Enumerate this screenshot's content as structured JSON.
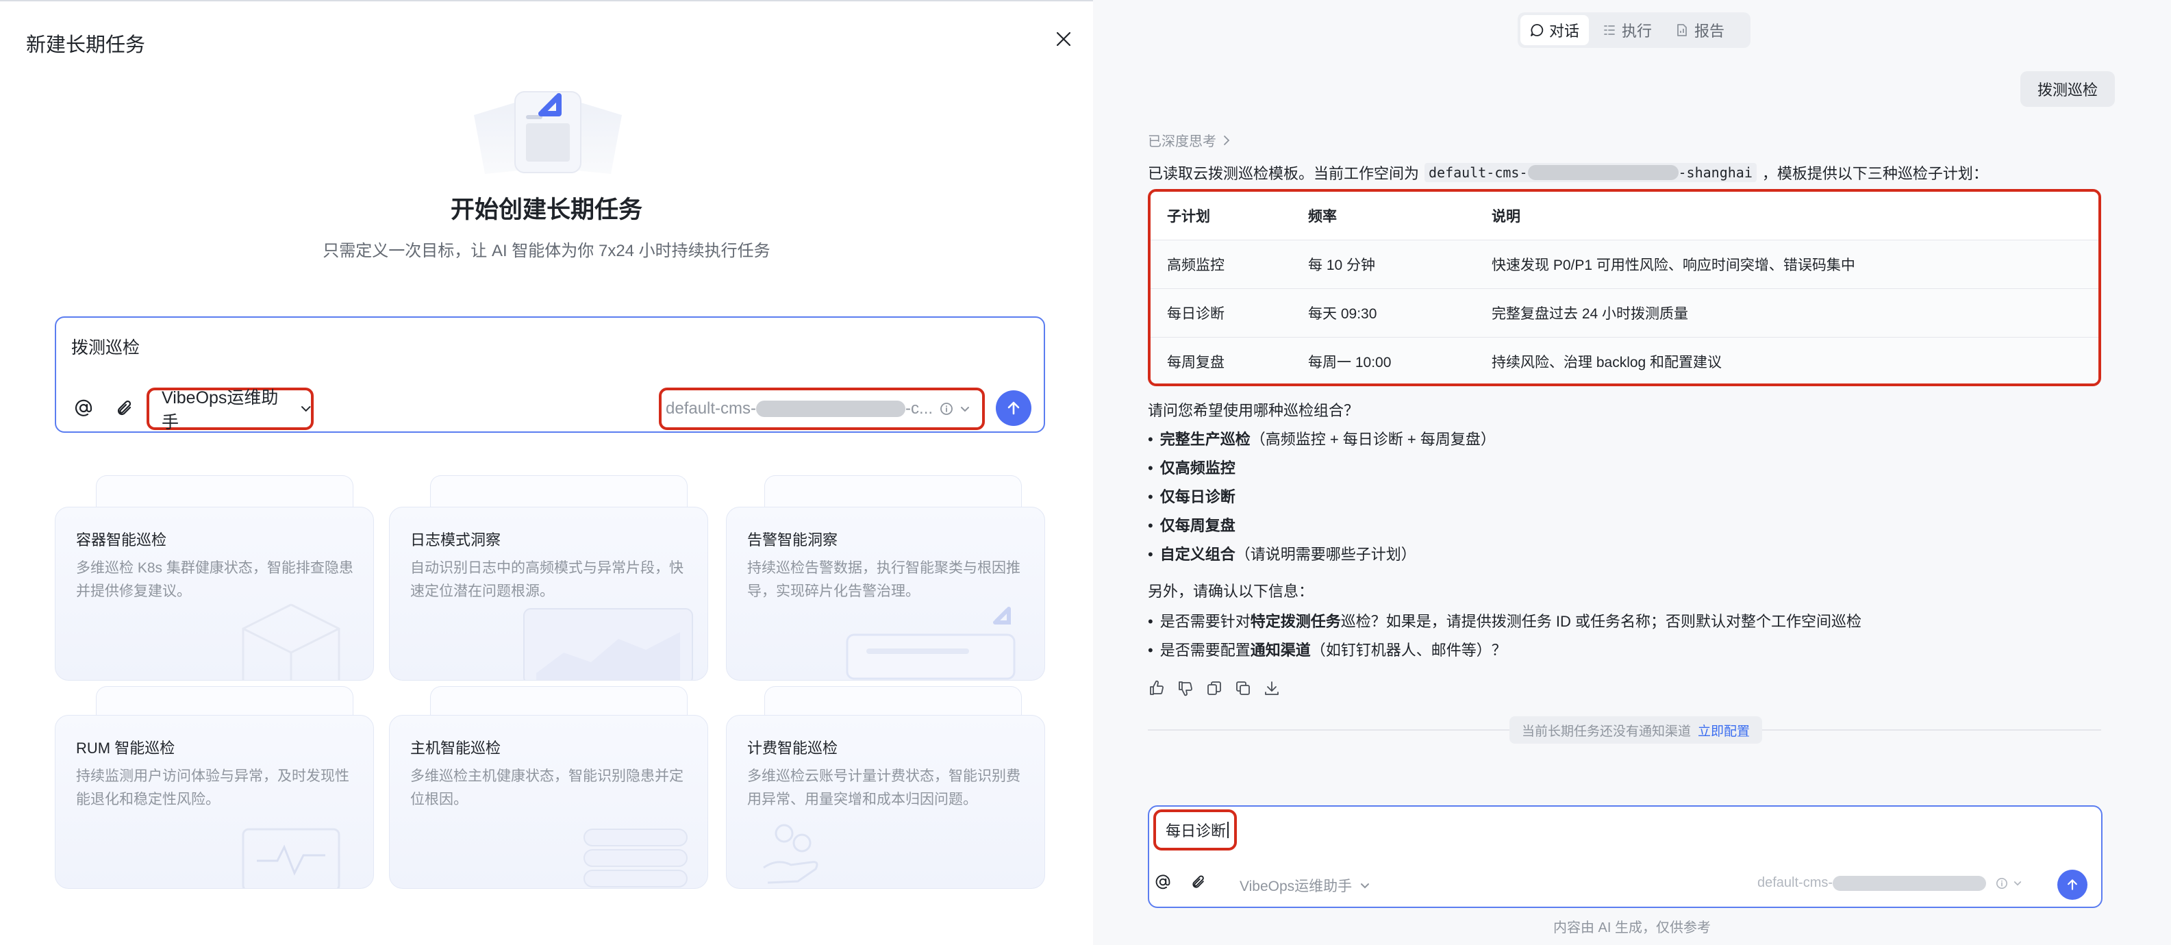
{
  "left": {
    "title": "新建长期任务",
    "hero_title": "开始创建长期任务",
    "hero_subtitle": "只需定义一次目标，让 AI 智能体为你 7x24 小时持续执行任务",
    "composer_text": "拨测巡检",
    "agent_label": "VibeOps运维助手",
    "workspace_prefix": "default-cms-",
    "workspace_suffix": "-c...",
    "cards": [
      {
        "title": "容器智能巡检",
        "desc": "多维巡检 K8s 集群健康状态，智能排查隐患并提供修复建议。"
      },
      {
        "title": "日志模式洞察",
        "desc": "自动识别日志中的高频模式与异常片段，快速定位潜在问题根源。"
      },
      {
        "title": "告警智能洞察",
        "desc": "持续巡检告警数据，执行智能聚类与根因推导，实现碎片化告警治理。"
      },
      {
        "title": "RUM 智能巡检",
        "desc": "持续监测用户访问体验与异常，及时发现性能退化和稳定性风险。"
      },
      {
        "title": "主机智能巡检",
        "desc": "多维巡检主机健康状态，智能识别隐患并定位根因。"
      },
      {
        "title": "计费智能巡检",
        "desc": "多维巡检云账号计量计费状态，智能识别费用异常、用量突增和成本归因问题。"
      }
    ]
  },
  "right": {
    "tabs": [
      {
        "label": "对话",
        "icon": "chat-icon"
      },
      {
        "label": "执行",
        "icon": "list-icon"
      },
      {
        "label": "报告",
        "icon": "report-icon"
      }
    ],
    "user_message": "拨测巡检",
    "thinking_label": "已深度思考",
    "intro_before": "已读取云拨测巡检模板。当前工作空间为",
    "code_prefix": "default-cms-",
    "code_suffix": "-shanghai",
    "intro_after": "，模板提供以下三种巡检子计划：",
    "table": {
      "headers": [
        "子计划",
        "频率",
        "说明"
      ],
      "rows": [
        [
          "高频监控",
          "每 10 分钟",
          "快速发现 P0/P1 可用性风险、响应时间突增、错误码集中"
        ],
        [
          "每日诊断",
          "每天 09:30",
          "完整复盘过去 24 小时拨测质量"
        ],
        [
          "每周复盘",
          "每周一 10:00",
          "持续风险、治理 backlog 和配置建议"
        ]
      ]
    },
    "question": "请问您希望使用哪种巡检组合？",
    "options": [
      {
        "bold": "完整生产巡检",
        "rest": "（高频监控 + 每日诊断 + 每周复盘）"
      },
      {
        "bold": "仅高频监控",
        "rest": ""
      },
      {
        "bold": "仅每日诊断",
        "rest": ""
      },
      {
        "bold": "仅每周复盘",
        "rest": ""
      },
      {
        "bold": "自定义组合",
        "rest": "（请说明需要哪些子计划）"
      }
    ],
    "confirm_label": "另外，请确认以下信息：",
    "confirm_items": [
      {
        "pre": "是否需要针对",
        "bold": "特定拨测任务",
        "post": "巡检？如果是，请提供拨测任务 ID 或任务名称；否则默认对整个工作空间巡检"
      },
      {
        "pre": "是否需要配置",
        "bold": "通知渠道",
        "post": "（如钉钉机器人、邮件等）？"
      }
    ],
    "notice_text": "当前长期任务还没有通知渠道",
    "notice_link": "立即配置",
    "input_value": "每日诊断",
    "agent_label": "VibeOps运维助手",
    "workspace_prefix": "default-cms-",
    "footer": "内容由 AI 生成，仅供参考"
  },
  "colors": {
    "accent": "#4e6ef2",
    "highlight": "#d42b1a",
    "link": "#3a6df0"
  }
}
